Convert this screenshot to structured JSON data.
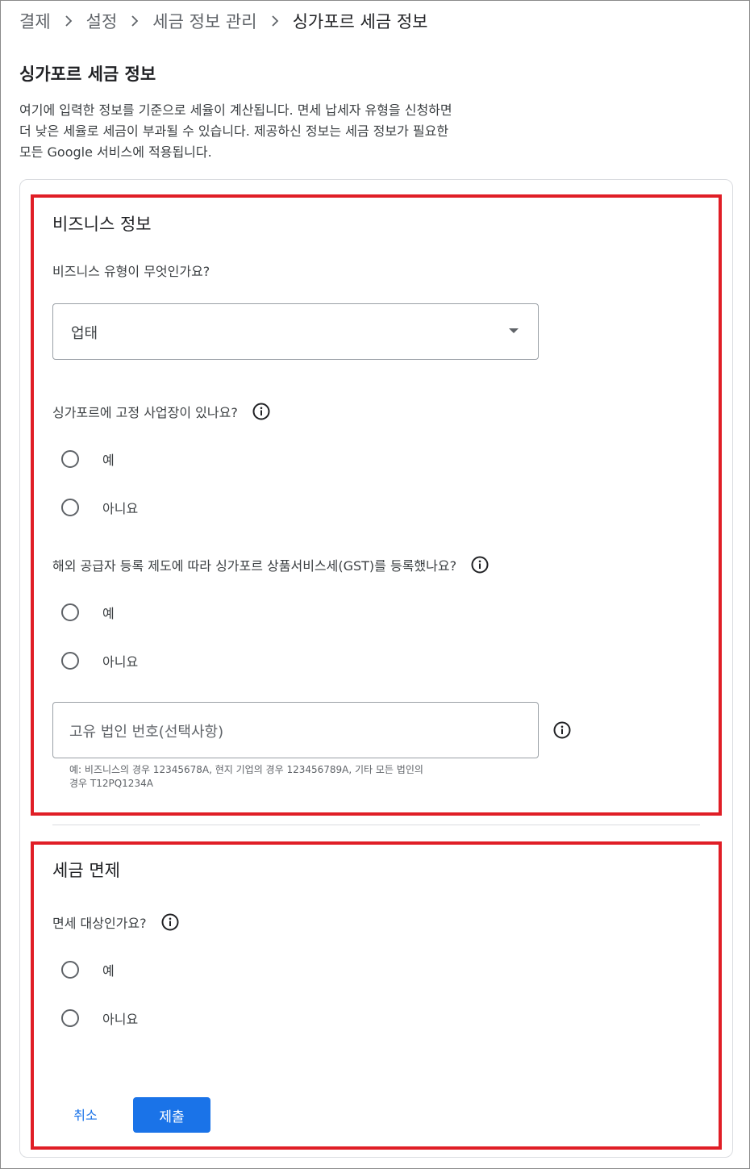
{
  "breadcrumb": {
    "items": [
      "결제",
      "설정",
      "세금 정보 관리",
      "싱가포르 세금 정보"
    ]
  },
  "page": {
    "title": "싱가포르 세금 정보",
    "intro": [
      "여기에 입력한 정보를 기준으로 세율이 계산됩니다. 면세 납세자 유형을 신청하면",
      "더 낮은 세율로 세금이 부과될 수 있습니다. 제공하신 정보는 세금 정보가 필요한",
      "모든 Google 서비스에 적용됩니다."
    ]
  },
  "business": {
    "heading": "비즈니스 정보",
    "type_question": "비즈니스 유형이 무엇인가요?",
    "type_select_value": "업태",
    "fixed_place_question": "싱가포르에 고정 사업장이 있나요?",
    "fixed_place_options": [
      "예",
      "아니요"
    ],
    "gst_question": "해외 공급자 등록 제도에 따라 싱가포르 상품서비스세(GST)를 등록했나요?",
    "gst_options": [
      "예",
      "아니요"
    ],
    "uen_placeholder": "고유 법인 번호(선택사항)",
    "uen_helper": [
      "예: 비즈니스의 경우 12345678A, 현지 기업의 경우 123456789A, 기타 모든 법인의",
      "경우 T12PQ1234A"
    ]
  },
  "exemption": {
    "heading": "세금 면제",
    "question": "면세 대상인가요?",
    "options": [
      "예",
      "아니요"
    ]
  },
  "actions": {
    "cancel": "취소",
    "submit": "제출"
  },
  "colors": {
    "accent": "#1a73e8",
    "highlight": "#e01e26"
  }
}
